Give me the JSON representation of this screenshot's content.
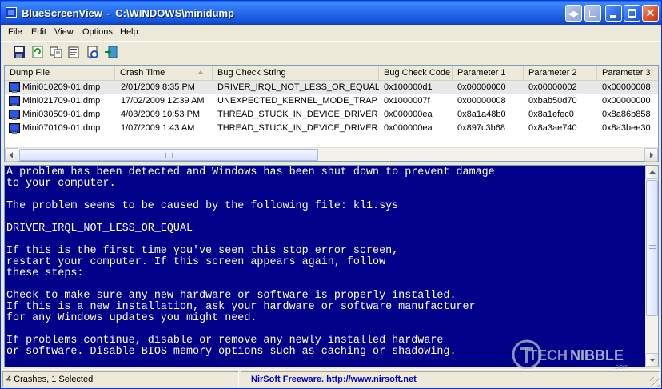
{
  "window": {
    "app_name": "BlueScreenView",
    "separator": "-",
    "path": "C:\\WINDOWS\\minidump"
  },
  "menu": [
    "File",
    "Edit",
    "View",
    "Options",
    "Help"
  ],
  "toolbar": {
    "icons": [
      "save-icon",
      "refresh-icon",
      "copy-icon",
      "properties-icon",
      "advanced-options-icon",
      "exit-icon"
    ]
  },
  "list": {
    "columns": [
      "Dump File",
      "Crash Time",
      "Bug Check String",
      "Bug Check Code",
      "Parameter 1",
      "Parameter 2",
      "Parameter 3"
    ],
    "sorted_column": "Crash Time",
    "rows": [
      {
        "dump_file": "Mini010209-01.dmp",
        "crash_time": "2/01/2009 8:35 PM",
        "bug_check_string": "DRIVER_IRQL_NOT_LESS_OR_EQUAL",
        "bug_check_code": "0x100000d1",
        "param1": "0x00000000",
        "param2": "0x00000002",
        "param3": "0x00000008",
        "selected": true
      },
      {
        "dump_file": "Mini021709-01.dmp",
        "crash_time": "17/02/2009 12:39 AM",
        "bug_check_string": "UNEXPECTED_KERNEL_MODE_TRAP",
        "bug_check_code": "0x1000007f",
        "param1": "0x00000008",
        "param2": "0xbab50d70",
        "param3": "0x00000000",
        "selected": false
      },
      {
        "dump_file": "Mini030509-01.dmp",
        "crash_time": "4/03/2009 10:53 PM",
        "bug_check_string": "THREAD_STUCK_IN_DEVICE_DRIVER",
        "bug_check_code": "0x000000ea",
        "param1": "0x8a1a48b0",
        "param2": "0x8a1efec0",
        "param3": "0x8a86b858",
        "selected": false
      },
      {
        "dump_file": "Mini070109-01.dmp",
        "crash_time": "1/07/2009 1:43 AM",
        "bug_check_string": "THREAD_STUCK_IN_DEVICE_DRIVER",
        "bug_check_code": "0x000000ea",
        "param1": "0x897c3b68",
        "param2": "0x8a3ae740",
        "param3": "0x8a3bee30",
        "selected": false
      }
    ]
  },
  "bsod": {
    "lines": [
      "A problem has been detected and Windows has been shut down to prevent damage",
      "to your computer.",
      "",
      "The problem seems to be caused by the following file: kl1.sys",
      "",
      "DRIVER_IRQL_NOT_LESS_OR_EQUAL",
      "",
      "If this is the first time you've seen this stop error screen,",
      "restart your computer. If this screen appears again, follow",
      "these steps:",
      "",
      "Check to make sure any new hardware or software is properly installed.",
      "If this is a new installation, ask your hardware or software manufacturer",
      "for any Windows updates you might need.",
      "",
      "If problems continue, disable or remove any newly installed hardware",
      "or software. Disable BIOS memory options such as caching or shadowing."
    ],
    "background": "#000088"
  },
  "watermark": {
    "text_dark": "TECH",
    "text_light": "NIBBLE",
    "sub": ".com"
  },
  "status": {
    "summary": "4 Crashes, 1 Selected",
    "credit": "NirSoft Freeware.  http://www.nirsoft.net"
  },
  "colors": {
    "titlebar": "#2a6fee",
    "selection": "#e8e8e8",
    "link": "#0000cc"
  }
}
